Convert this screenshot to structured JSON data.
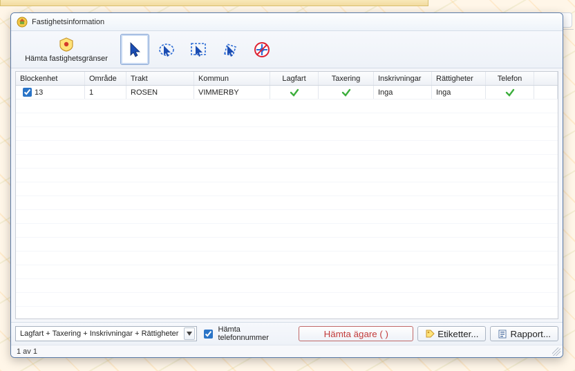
{
  "window": {
    "title": "Fastighetsinformation"
  },
  "toolbar": {
    "fetch_boundaries_label": "Hämta fastighetsgränser"
  },
  "columns": {
    "blockenhet": "Blockenhet",
    "omrade": "Område",
    "trakt": "Trakt",
    "kommun": "Kommun",
    "lagfart": "Lagfart",
    "taxering": "Taxering",
    "inskrivningar": "Inskrivningar",
    "rattigheter": "Rättigheter",
    "telefon": "Telefon"
  },
  "rows": [
    {
      "checked": true,
      "blockenhet": "13",
      "omrade": "1",
      "trakt": "ROSEN",
      "kommun": "VIMMERBY",
      "lagfart": "check",
      "taxering": "check",
      "inskrivningar": "Inga",
      "rattigheter": "Inga",
      "telefon": "check"
    }
  ],
  "bottom": {
    "combo_selected": "Lagfart + Taxering + Inskrivningar + Rättigheter",
    "fetch_phone_label": "Hämta telefonnummer",
    "fetch_phone_checked": true,
    "fetch_owners_label": "Hämta ägare (             )",
    "labels_button": "Etiketter...",
    "report_button": "Rapport..."
  },
  "status": {
    "count_text": "1 av 1"
  },
  "icons": {
    "check": "✓"
  }
}
